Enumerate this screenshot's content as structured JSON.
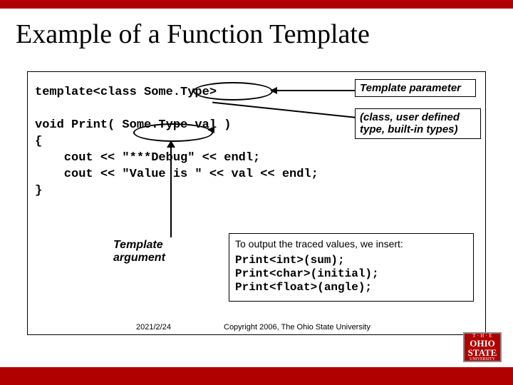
{
  "title": "Example of a Function Template",
  "code": "template<class Some.Type>\n\nvoid Print( Some.Type val )\n{\n    cout << \"***Debug\" << endl;\n    cout << \"Value is \" << val << endl;\n}",
  "annotations": {
    "template_param": "Template parameter",
    "param_note": "(class, user defined type, built-in types)",
    "template_arg": "Template\nargument"
  },
  "insert": {
    "caption": "To output the traced values, we insert:",
    "code": "Print<int>(sum);\nPrint<char>(initial);\nPrint<float>(angle);"
  },
  "footer": {
    "date": "2021/2/24",
    "copyright": "Copyright 2006, The Ohio State University"
  },
  "logo": {
    "the": "T · H · E",
    "ohio": "OHIO",
    "state": "STATE",
    "univ": "UNIVERSITY"
  }
}
